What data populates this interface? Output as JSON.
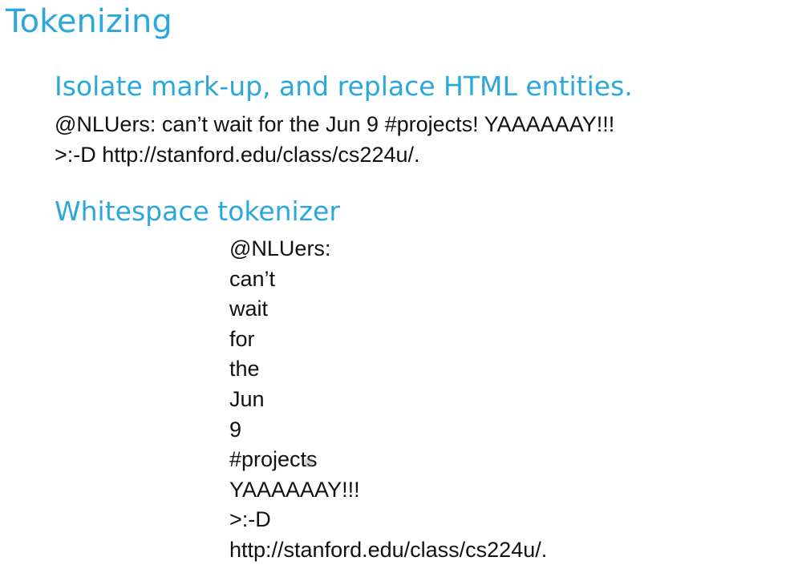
{
  "slide": {
    "title": "Tokenizing",
    "section1": {
      "heading": "Isolate mark-up, and replace HTML entities.",
      "lines": [
        "@NLUers: can’t wait for the Jun 9 #projects! YAAAAAAY!!!",
        ">:-D http://stanford.edu/class/cs224u/."
      ]
    },
    "section2": {
      "heading": "Whitespace tokenizer",
      "tokens": [
        "@NLUers:",
        "can’t",
        "wait",
        "for",
        "the",
        "Jun",
        "9",
        "#projects",
        "YAAAAAAY!!!",
        ">:-D",
        "http://stanford.edu/class/cs224u/."
      ]
    },
    "colors": {
      "accent": "#2aa7dc",
      "text": "#111111",
      "background": "#ffffff"
    }
  }
}
